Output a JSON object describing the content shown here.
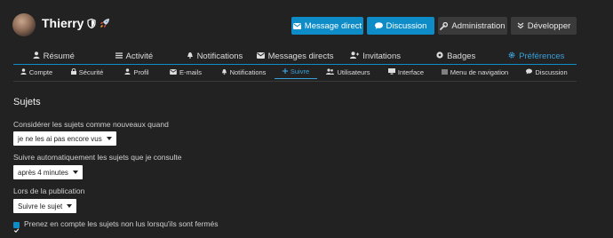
{
  "user": {
    "name": "Thierry"
  },
  "actions": {
    "message": "Message direct",
    "discussion": "Discussion",
    "admin": "Administration",
    "dev": "Développer"
  },
  "tabs_primary": [
    {
      "label": "Résumé",
      "icon": "user-icon"
    },
    {
      "label": "Activité",
      "icon": "list-icon"
    },
    {
      "label": "Notifications",
      "icon": "bell-icon"
    },
    {
      "label": "Messages directs",
      "icon": "envelope-icon"
    },
    {
      "label": "Invitations",
      "icon": "user-plus-icon"
    },
    {
      "label": "Badges",
      "icon": "certificate-icon"
    },
    {
      "label": "Préférences",
      "icon": "gear-icon",
      "active": true
    }
  ],
  "tabs_secondary": [
    {
      "label": "Compte",
      "icon": "user-icon"
    },
    {
      "label": "Sécurité",
      "icon": "lock-icon"
    },
    {
      "label": "Profil",
      "icon": "user-icon"
    },
    {
      "label": "E-mails",
      "icon": "envelope-icon"
    },
    {
      "label": "Notifications",
      "icon": "bell-icon"
    },
    {
      "label": "Suivre",
      "icon": "plus-icon",
      "active": true
    },
    {
      "label": "Utilisateurs",
      "icon": "users-icon"
    },
    {
      "label": "Interface",
      "icon": "desktop-icon"
    },
    {
      "label": "Menu de navigation",
      "icon": "bars-icon"
    },
    {
      "label": "Discussion",
      "icon": "comment-icon"
    }
  ],
  "section": {
    "title": "Sujets",
    "fields": [
      {
        "label": "Considérer les sujets comme nouveaux quand",
        "value": "je ne les ai pas encore vus"
      },
      {
        "label": "Suivre automatiquement les sujets que je consulte",
        "value": "après 4 minutes"
      },
      {
        "label": "Lors de la publication",
        "value": "Suivre le sujet"
      }
    ],
    "checkbox": {
      "label": "Prenez en compte les sujets non lus lorsqu'ils sont fermés",
      "checked": true
    }
  },
  "colors": {
    "accent": "#0d8cc7",
    "background": "#222222",
    "secondary_button": "#3a3a3a"
  }
}
